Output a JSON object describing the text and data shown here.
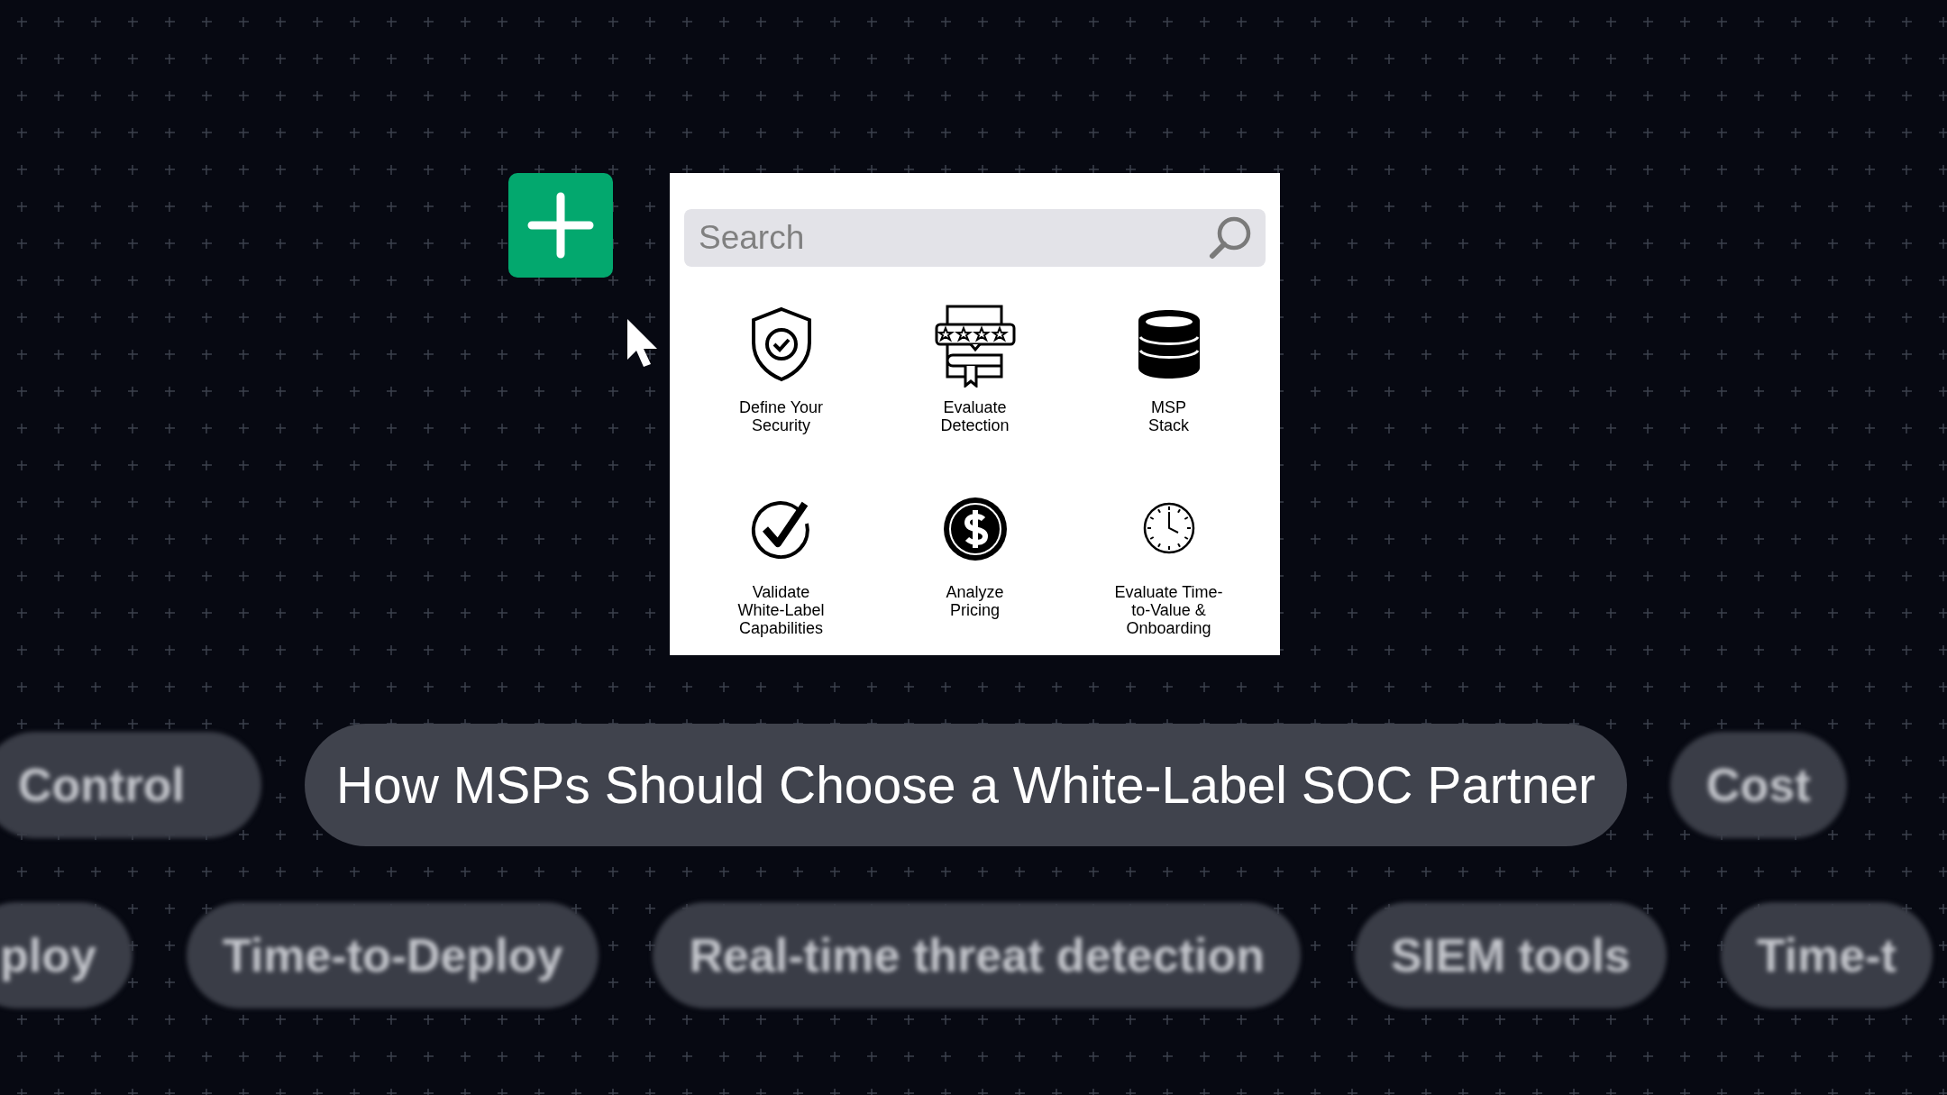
{
  "search": {
    "placeholder": "Search"
  },
  "items": [
    {
      "label": "Define Your\nSecurity"
    },
    {
      "label": "Evaluate\nDetection"
    },
    {
      "label": "MSP\nStack"
    },
    {
      "label": "Validate\nWhite-Label\nCapabilities"
    },
    {
      "label": "Analyze\nPricing"
    },
    {
      "label": "Evaluate Time-\nto-Value &\nOnboarding"
    }
  ],
  "title": "How MSPs Should Choose a White-Label SOC Partner",
  "side_tags": [
    {
      "label": "Control"
    },
    {
      "label": "Cost"
    }
  ],
  "tags": [
    {
      "label": "ploy"
    },
    {
      "label": "Time-to-Deploy"
    },
    {
      "label": "Real-time threat detection"
    },
    {
      "label": "SIEM tools"
    },
    {
      "label": "Time-t"
    }
  ]
}
